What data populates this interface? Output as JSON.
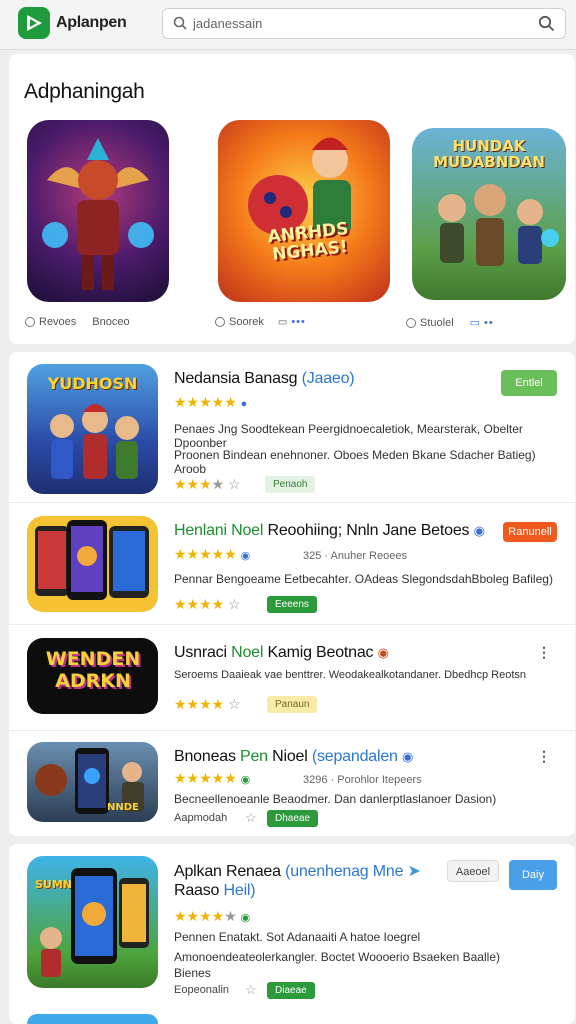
{
  "header": {
    "brand": "Aplanpen",
    "search_value": "jadanessain"
  },
  "featured": {
    "title": "Adphaningah",
    "tiles": [
      {
        "caption_a": "Revoes",
        "caption_b": "Bnoceo",
        "art_title": ""
      },
      {
        "caption_a": "Soorek",
        "caption_b": "",
        "art_title": "ANRHDS NGHAS!"
      },
      {
        "caption_a": "Stuolel",
        "caption_b": "",
        "art_title": "HUNDAK MUDABNDAN"
      }
    ]
  },
  "list": [
    {
      "title_a": "Nedansia Banasg",
      "title_b": "(Jaaeo)",
      "button": "Entlel",
      "desc_1": "Penaes Jng Soodtekean Peergidnoecaletiok, Mearsterak, Obelter Dpoonber",
      "desc_2": "Proonen Bindean enehnoner. Oboes Meden Bkane Sdacher Batieg) Aroob",
      "badge": "Penaoh",
      "icon_text": "YUDHOSN"
    },
    {
      "title_a": "Henlani",
      "title_hl": "Noel",
      "title_b": "Reoohiing; Nnln Jane Betoes",
      "button": "Ranunell",
      "meta": "325 · Anuher Reoees",
      "desc_1": "Pennar Bengoeame Eetbecahter. OAdeas SlegondsdahBboleg Bafileg)",
      "badge": "Eeeens"
    },
    {
      "title_a": "Usnraci",
      "title_hl": "Noel",
      "title_b": "Kamig Beotnac",
      "desc_1": "Seroems Daaieak vae benttrer. Weodakealkotandaner. Dbedhcp Reotsn",
      "badge": "Panaun",
      "icon_text": "WENDEN ADRKN"
    },
    {
      "title_a": "Bnoneas",
      "title_hl": "Pen",
      "title_b": "Nioel",
      "title_c": "(sepandalen",
      "meta": "3296 · Porohlor Itepeers",
      "desc_1": "Becneellenoeanle Beaodmer. Dan danlerptlaslanoer Dasion)",
      "meta2": "Aapmodah",
      "badge": "Dhaeae",
      "icon_text": "NNDE"
    }
  ],
  "list2": [
    {
      "title_a": "Aplkan Renaea",
      "title_b": "(unenhenag Mne",
      "title_c": "Raaso",
      "title_d": "Heil)",
      "button_secondary": "Aaeoel",
      "button": "Daiy",
      "desc_1": "Pennen Enatakt. Sot Adanaaiti A hatoe Ioegrel",
      "desc_2": "Amonoendeateolerkangler. Boctet Woooerio Bsaeken Baalle)",
      "desc_3": "Bienes",
      "meta2": "Eopeonalin",
      "badge": "Diaeae",
      "icon_text": "SUMNER"
    }
  ]
}
